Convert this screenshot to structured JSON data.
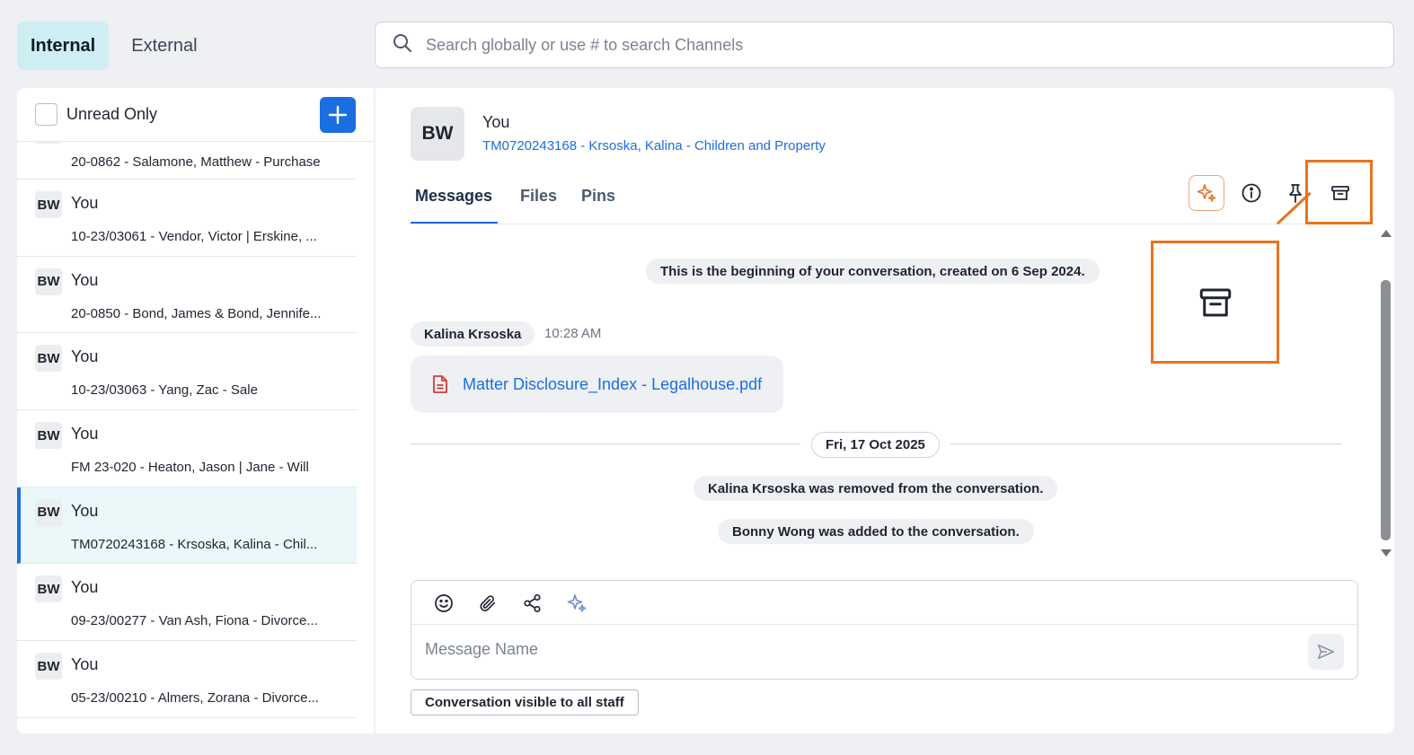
{
  "top": {
    "tabs": [
      {
        "label": "Internal",
        "active": true
      },
      {
        "label": "External",
        "active": false
      }
    ],
    "search_placeholder": "Search globally or use # to search Channels"
  },
  "sidebar": {
    "unread_only_label": "Unread Only",
    "add_icon": "plus-icon",
    "partial_item_sub": "20-0862 - Salamone, Matthew - Purchase",
    "items": [
      {
        "avatar": "BW",
        "name": "You",
        "sub": "10-23/03061 - Vendor, Victor | Erskine, ..."
      },
      {
        "avatar": "BW",
        "name": "You",
        "sub": "20-0850 - Bond, James & Bond, Jennife..."
      },
      {
        "avatar": "BW",
        "name": "You",
        "sub": "10-23/03063 - Yang, Zac - Sale"
      },
      {
        "avatar": "BW",
        "name": "You",
        "sub": "FM 23-020 - Heaton, Jason | Jane - Will"
      },
      {
        "avatar": "BW",
        "name": "You",
        "sub": "TM0720243168 - Krsoska, Kalina - Chil...",
        "selected": true
      },
      {
        "avatar": "BW",
        "name": "You",
        "sub": "09-23/00277 - Van Ash, Fiona - Divorce..."
      },
      {
        "avatar": "BW",
        "name": "You",
        "sub": "05-23/00210 - Almers, Zorana - Divorce..."
      }
    ]
  },
  "conversation": {
    "avatar": "BW",
    "name": "You",
    "subtitle": "TM0720243168 - Krsoska, Kalina - Children and Property",
    "tabs": [
      "Messages",
      "Files",
      "Pins"
    ],
    "active_tab": "Messages",
    "header_icons": [
      "sparkle-icon",
      "info-icon",
      "pin-icon",
      "archive-icon"
    ],
    "beginning_notice": "This is the beginning of your conversation, created on 6 Sep 2024.",
    "message": {
      "sender": "Kalina Krsoska",
      "time": "10:28 AM",
      "file_name": "Matter Disclosure_Index - Legalhouse.pdf"
    },
    "date_divider": "Fri, 17 Oct 2025",
    "events": [
      "Kalina Krsoska was removed from the conversation.",
      "Bonny Wong was added to the conversation."
    ],
    "composer": {
      "tools": [
        "emoji-icon",
        "attachment-icon",
        "share-icon",
        "sparkle-icon"
      ],
      "placeholder": "Message Name"
    },
    "visibility_label": "Conversation visible to all staff"
  },
  "colors": {
    "accent": "#1a6fe0",
    "highlight": "#e8731f",
    "selected_row": "#eaf8fa",
    "active_tab_bg": "#cfeef4"
  }
}
